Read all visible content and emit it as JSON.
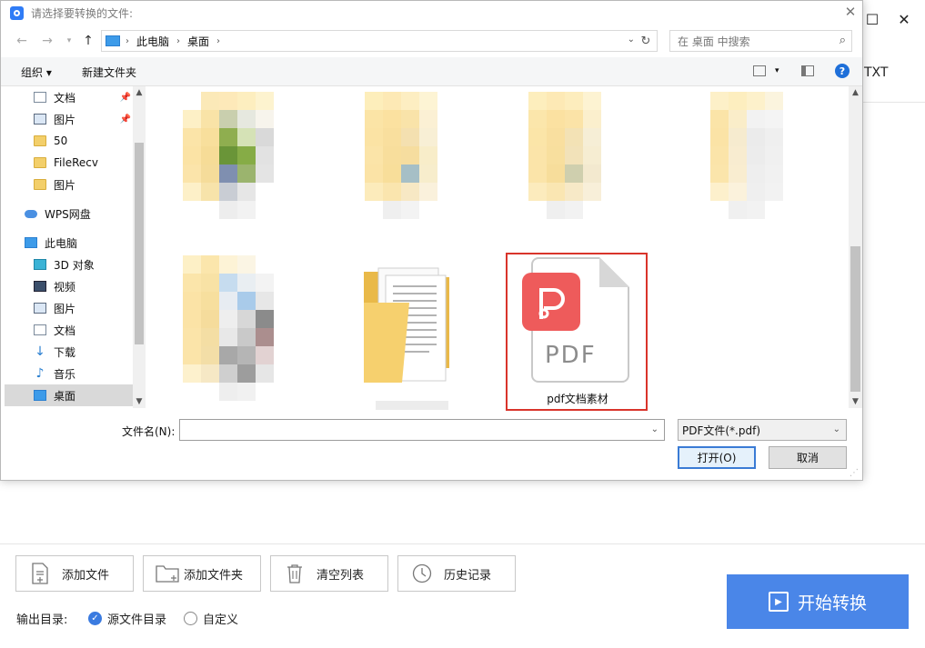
{
  "background_app": {
    "partial_title": "TXT",
    "toolbar": {
      "add_file": "添加文件",
      "add_folder": "添加文件夹",
      "clear_list": "清空列表",
      "history": "历史记录"
    },
    "output": {
      "label": "输出目录:",
      "option_source": "源文件目录",
      "option_custom": "自定义",
      "selected": "源文件目录"
    },
    "start_button": "开始转换",
    "accent_color": "#4a86e8"
  },
  "dialog": {
    "title": "请选择要转换的文件:",
    "address": {
      "crumbs": [
        "此电脑",
        "桌面"
      ]
    },
    "search_placeholder": "在 桌面 中搜索",
    "commands": {
      "organize": "组织 ▾",
      "new_folder": "新建文件夹"
    },
    "nav_items": [
      {
        "label": "文档",
        "icon": "document-icon",
        "pinned": true
      },
      {
        "label": "图片",
        "icon": "picture-icon",
        "pinned": true
      },
      {
        "label": "50",
        "icon": "folder-icon"
      },
      {
        "label": "FileRecv",
        "icon": "folder-icon"
      },
      {
        "label": "图片",
        "icon": "folder-icon"
      },
      {
        "label": "WPS网盘",
        "icon": "cloud-icon"
      },
      {
        "label": "此电脑",
        "icon": "computer-icon"
      },
      {
        "label": "3D 对象",
        "icon": "cube-icon"
      },
      {
        "label": "视频",
        "icon": "video-icon"
      },
      {
        "label": "图片",
        "icon": "picture-icon"
      },
      {
        "label": "文档",
        "icon": "document-icon"
      },
      {
        "label": "下载",
        "icon": "download-icon"
      },
      {
        "label": "音乐",
        "icon": "music-icon"
      },
      {
        "label": "桌面",
        "icon": "desktop-icon",
        "selected": true
      }
    ],
    "files": [
      {
        "name": "pdf文档素材",
        "type": "pdf",
        "selected": true
      }
    ],
    "filename_label": "文件名(N):",
    "filename_value": "",
    "filetype": "PDF文件(*.pdf)",
    "open_button": "打开(O)",
    "cancel_button": "取消",
    "highlight_color": "#d9342b"
  }
}
